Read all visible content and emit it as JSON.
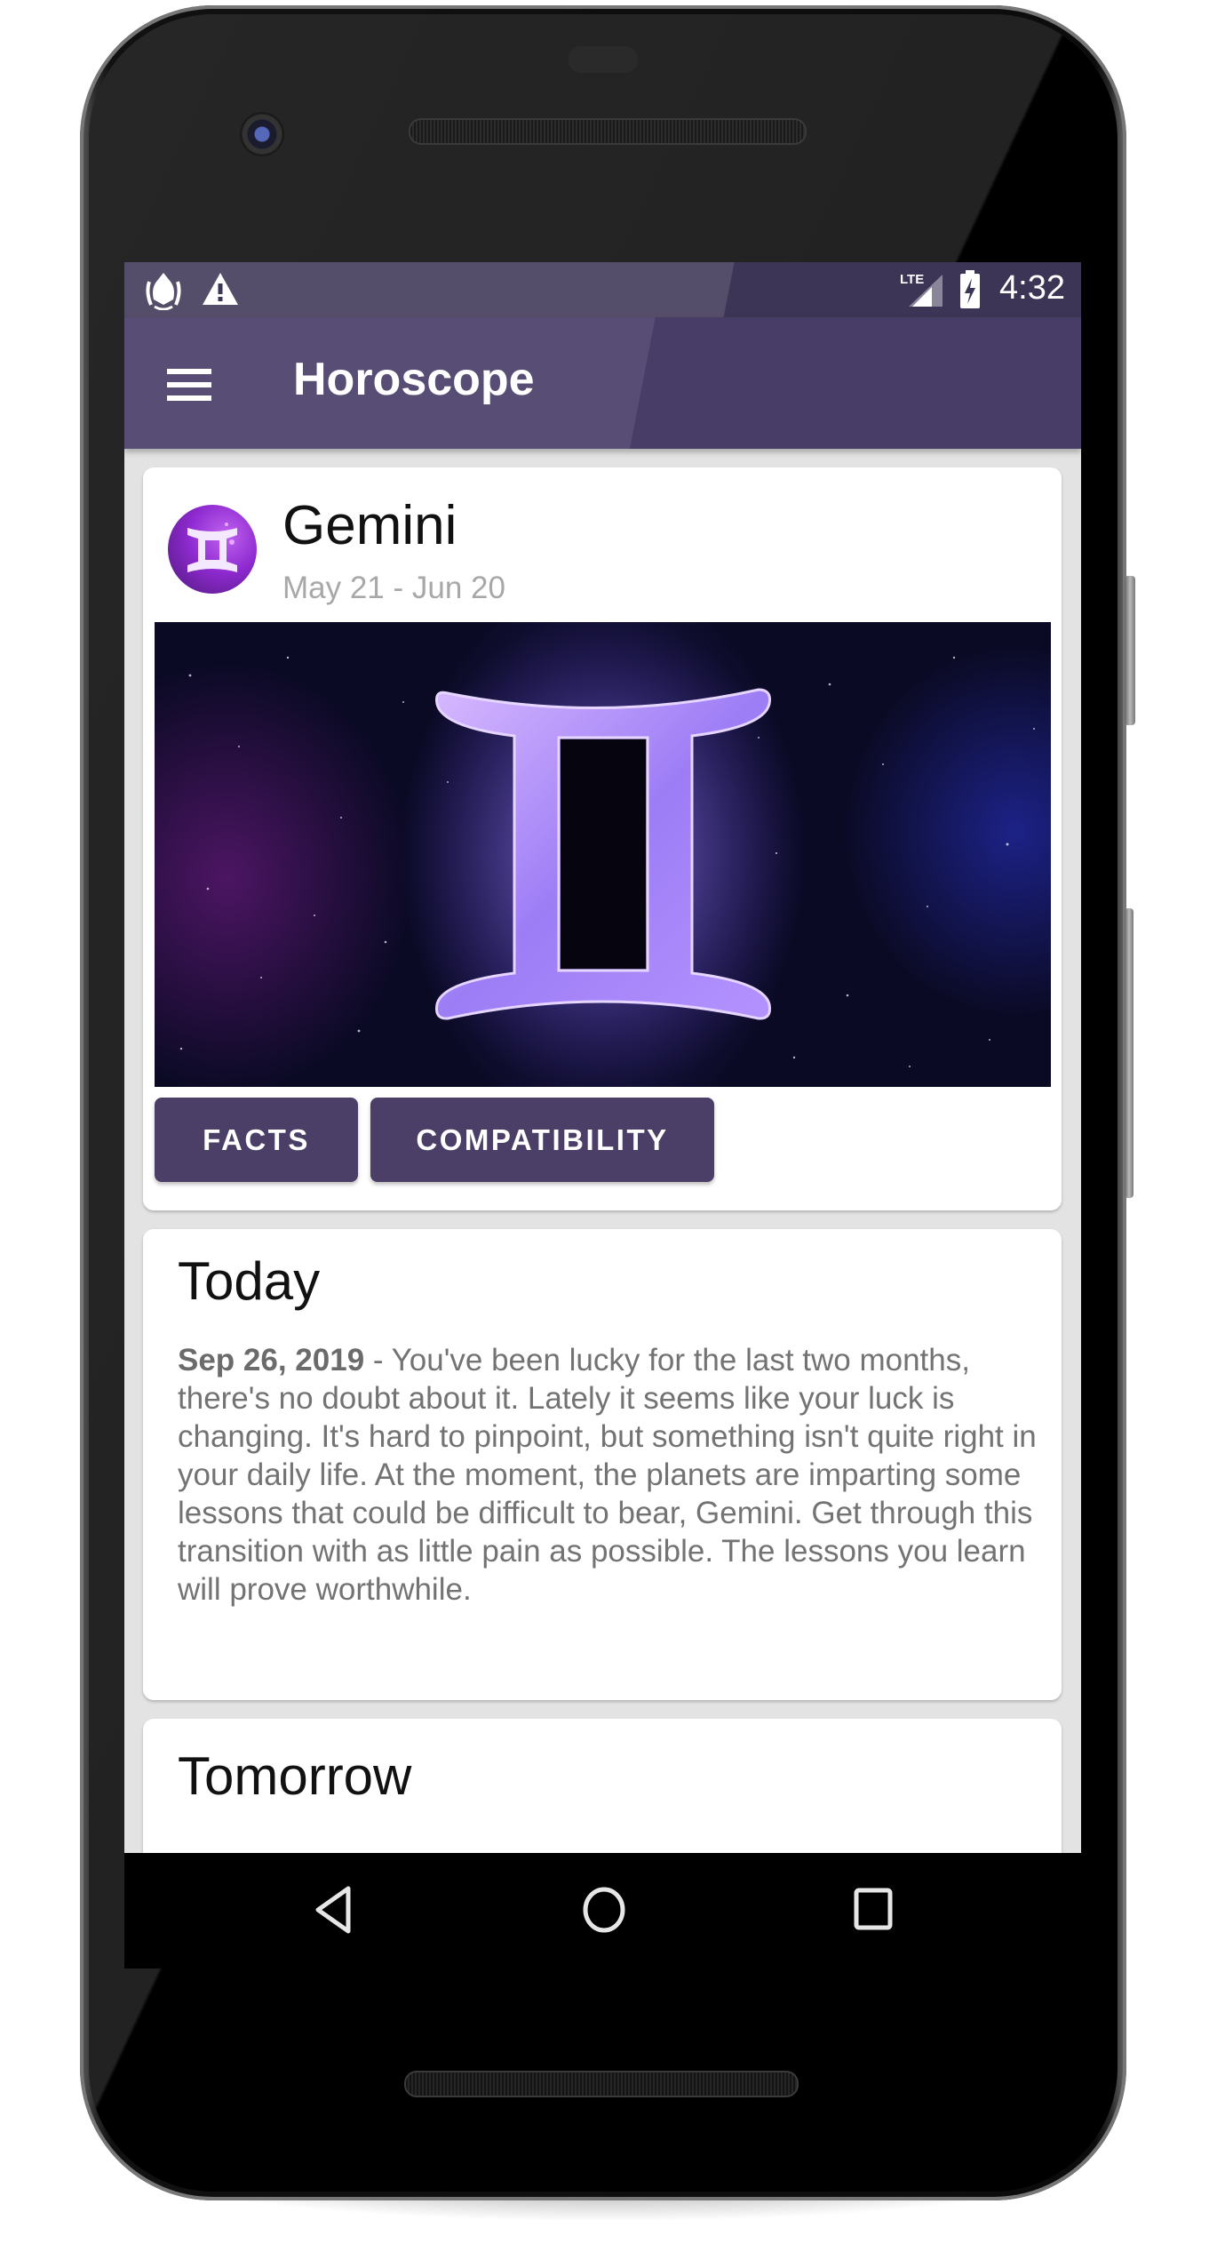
{
  "status_bar": {
    "left_icons": [
      "android-debug-icon",
      "warning-icon"
    ],
    "network": "LTE",
    "right_icons": [
      "lte-signal-icon",
      "battery-charging-icon"
    ],
    "time": "4:32"
  },
  "app_bar": {
    "menu_icon": "hamburger-menu-icon",
    "title": "Horoscope"
  },
  "sign_card": {
    "avatar_icon": "gemini-symbol-icon",
    "name": "Gemini",
    "dates": "May 21 - Jun 20",
    "hero_image": "gemini-glowing-symbol-on-starfield",
    "buttons": [
      {
        "label": "FACTS"
      },
      {
        "label": "COMPATIBILITY"
      }
    ]
  },
  "today": {
    "title": "Today",
    "date": "Sep 26, 2019",
    "separator": " - ",
    "text": "You've been lucky for the last two months, there's no doubt about it. Lately it seems like your luck is changing. It's hard to pinpoint, but something isn't quite right in your daily life. At the moment, the planets are imparting some lessons that could be difficult to bear, Gemini. Get through this transition with as little pain as possible. The lessons you learn will prove worthwhile."
  },
  "tomorrow": {
    "title": "Tomorrow"
  },
  "nav_bar": {
    "back": "back-icon",
    "home": "home-icon",
    "recents": "recents-icon"
  },
  "colors": {
    "primary": "#483d67",
    "primary_dark": "#3d3555",
    "button": "#4b3f67",
    "background": "#e3e3e3",
    "subtitle": "#a8a8a8",
    "body_text": "#737373"
  }
}
